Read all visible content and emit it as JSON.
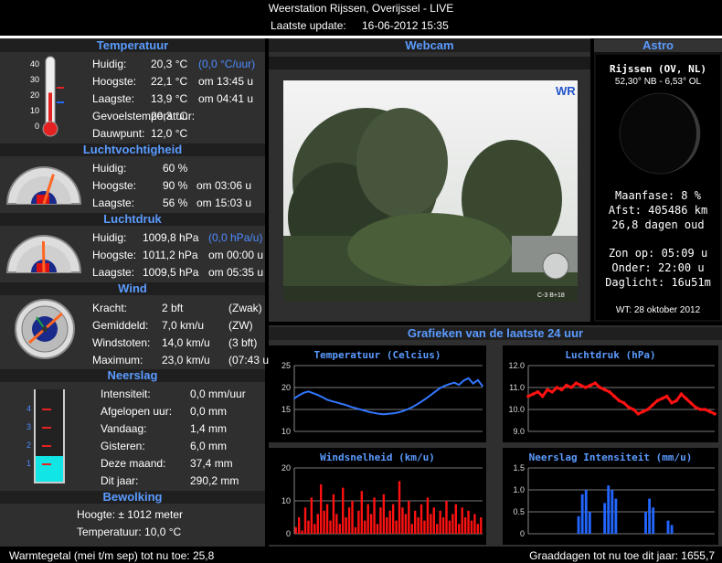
{
  "header": {
    "title": "Weerstation Rijssen, Overijssel - LIVE",
    "update_label": "Laatste update:",
    "update_value": "16-06-2012 15:35"
  },
  "sections": {
    "temperature": "Temperatuur",
    "humidity": "Luchtvochtigheid",
    "pressure": "Luchtdruk",
    "wind": "Wind",
    "rain": "Neerslag",
    "clouds": "Bewolking",
    "webcam": "Webcam",
    "astro": "Astro",
    "graphs": "Grafieken van de laatste 24 uur"
  },
  "temperature": {
    "scale": [
      "40",
      "30",
      "20",
      "10",
      "0"
    ],
    "rows": [
      {
        "label": "Huidig:",
        "value": "20,3 °C",
        "extra": "(0,0 °C/uur)"
      },
      {
        "label": "Hoogste:",
        "value": "22,1 °C",
        "extra": "om 13:45 u"
      },
      {
        "label": "Laagste:",
        "value": "13,9 °C",
        "extra": "om 04:41 u"
      },
      {
        "label": "Gevoelstemperatuur:",
        "value": "20,3 °C",
        "extra": ""
      },
      {
        "label": "Dauwpunt:",
        "value": "12,0 °C",
        "extra": ""
      }
    ],
    "current": 20.3,
    "max": 22.1,
    "min": 13.9
  },
  "humidity": {
    "rows": [
      {
        "label": "Huidig:",
        "value": "60 %",
        "extra": ""
      },
      {
        "label": "Hoogste:",
        "value": "90 %",
        "extra": "om 03:06 u"
      },
      {
        "label": "Laagste:",
        "value": "56 %",
        "extra": "om 15:03 u"
      }
    ],
    "current": 60
  },
  "pressure": {
    "rows": [
      {
        "label": "Huidig:",
        "value": "1009,8 hPa",
        "extra": "(0,0 hPa/u)"
      },
      {
        "label": "Hoogste:",
        "value": "1011,2 hPa",
        "extra": "om 00:00 u"
      },
      {
        "label": "Laagste:",
        "value": "1009,5 hPa",
        "extra": "om 05:35 u"
      }
    ],
    "current": 1009.8
  },
  "wind": {
    "rows": [
      {
        "label": "Kracht:",
        "value": "2 bft",
        "extra": "(Zwak)"
      },
      {
        "label": "Gemiddeld:",
        "value": "7,0 km/u",
        "extra": "(ZW)"
      },
      {
        "label": "Windstoten:",
        "value": "14,0 km/u",
        "extra": "(3 bft)"
      },
      {
        "label": "Maximum:",
        "value": "23,0 km/u",
        "extra": "(07:43 u)"
      }
    ]
  },
  "rain": {
    "scale": [
      "4",
      "3",
      "2",
      "1"
    ],
    "rows": [
      {
        "label": "Intensiteit:",
        "value": "0,0 mm/uur"
      },
      {
        "label": "Afgelopen uur:",
        "value": "0,0 mm"
      },
      {
        "label": "Vandaag:",
        "value": "1,4 mm"
      },
      {
        "label": "Gisteren:",
        "value": "6,0 mm"
      },
      {
        "label": "Deze maand:",
        "value": "37,4 mm"
      },
      {
        "label": "Dit jaar:",
        "value": "290,2 mm"
      }
    ],
    "fill_level": 1.4
  },
  "clouds": {
    "height": "Hoogte: ± 1012 meter",
    "temp": "Temperatuur: 10,0 °C"
  },
  "webcam": {
    "logo": "WR",
    "stamp": "C-3 B+18"
  },
  "astro": {
    "place": "Rijssen (OV, NL)",
    "coords": "52,30° NB - 6,53° OL",
    "moon_phase": "Maanfase: 8 %",
    "distance": "Afst: 405486 km",
    "age": "26,8 dagen oud",
    "sunrise": "Zon op: 05:09 u",
    "sunset": "Onder: 22:00 u",
    "daylight": "Daglicht: 16u51m",
    "footer": "WT: 28 oktober 2012"
  },
  "footer": {
    "left": "Warmtegetal (mei t/m sep) tot nu toe: 25,8",
    "right": "Graaddagen tot nu toe dit jaar: 1655,7"
  },
  "chart_data": [
    {
      "type": "line",
      "title": "Temperatuur (Celcius)",
      "ylim": [
        10,
        25
      ],
      "yticks": [
        "25",
        "20",
        "15",
        "10"
      ],
      "color": "#3377ff",
      "values": [
        17.5,
        18.2,
        18.8,
        19.1,
        18.7,
        18.3,
        17.8,
        17.2,
        16.9,
        16.6,
        16.3,
        16.0,
        15.6,
        15.3,
        15.0,
        14.7,
        14.4,
        14.2,
        14.0,
        13.9,
        14.0,
        14.1,
        14.3,
        14.6,
        15.0,
        15.5,
        16.1,
        16.8,
        17.5,
        18.3,
        19.1,
        19.9,
        20.4,
        20.8,
        21.1,
        20.6,
        21.6,
        22.1,
        20.9,
        21.7,
        20.3
      ]
    },
    {
      "type": "line",
      "title": "Luchtdruk (hPa)",
      "ylim": [
        9.0,
        12.0
      ],
      "yticks": [
        "12.0",
        "11.0",
        "10.0",
        "9.0"
      ],
      "color": "#ff1111",
      "values": [
        10.6,
        10.7,
        10.8,
        10.6,
        10.9,
        10.8,
        11.0,
        10.9,
        11.1,
        11.0,
        11.2,
        11.1,
        11.0,
        11.1,
        11.2,
        11.0,
        10.9,
        10.8,
        10.6,
        10.4,
        10.3,
        10.1,
        10.0,
        9.8,
        9.9,
        10.0,
        10.2,
        10.4,
        10.5,
        10.6,
        10.3,
        10.4,
        10.7,
        10.5,
        10.3,
        10.1,
        10.0,
        10.0,
        9.9,
        9.8
      ]
    },
    {
      "type": "bar",
      "title": "Windsnelheid (km/u)",
      "ylim": [
        0,
        20
      ],
      "yticks": [
        "20",
        "10",
        "0"
      ],
      "color": "#ff1111",
      "values": [
        2,
        5,
        1,
        8,
        4,
        11,
        3,
        6,
        15,
        7,
        9,
        4,
        12,
        6,
        3,
        14,
        5,
        8,
        10,
        2,
        7,
        13,
        4,
        9,
        6,
        11,
        3,
        8,
        12,
        5,
        7,
        9,
        4,
        16,
        8,
        6,
        10,
        3,
        7,
        5,
        9,
        4,
        11,
        6,
        8,
        3,
        7,
        5,
        10,
        4,
        6,
        9,
        3,
        8,
        5,
        7,
        4,
        6,
        3,
        5
      ]
    },
    {
      "type": "bar",
      "title": "Neerslag Intensiteit (mm/u)",
      "ylim": [
        0,
        1.5
      ],
      "yticks": [
        "1.5",
        "1.0",
        "0.5",
        "0"
      ],
      "color": "#2266ff",
      "values": [
        0,
        0,
        0,
        0,
        0,
        0,
        0,
        0,
        0,
        0,
        0,
        0,
        0,
        0.4,
        0.9,
        1.0,
        0.5,
        0,
        0,
        0,
        0.7,
        1.1,
        1.0,
        0.8,
        0,
        0,
        0,
        0,
        0,
        0,
        0,
        0.5,
        0.8,
        0.6,
        0,
        0,
        0,
        0.3,
        0.2,
        0,
        0,
        0,
        0,
        0,
        0,
        0,
        0,
        0,
        0,
        0
      ]
    }
  ],
  "colors": {
    "section_title": "#5b9bff",
    "panel": "#2f2f2f",
    "highlight": "#4d8bff"
  }
}
